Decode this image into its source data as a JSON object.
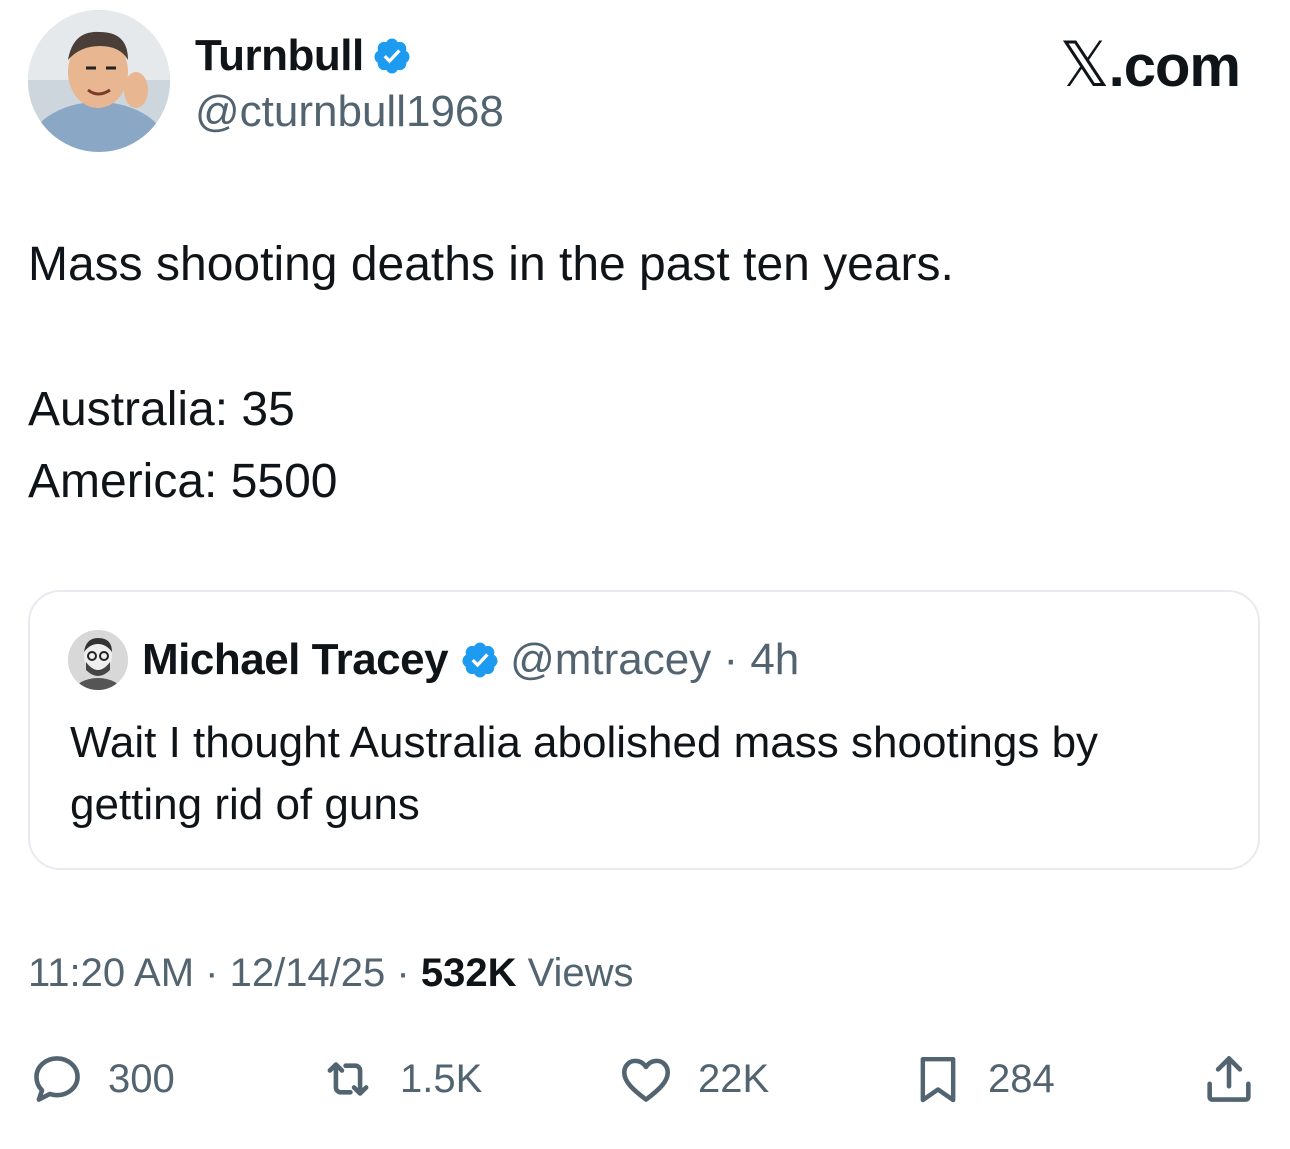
{
  "tweet": {
    "author": {
      "name": "Turnbull",
      "handle": "@cturnbull1968",
      "verified": true
    },
    "brand": {
      "label_x": "𝕏",
      "label_domain": ".com"
    },
    "lines": [
      "Mass shooting deaths in the past ten years.",
      "Australia: 35",
      "America: 5500"
    ],
    "quote": {
      "name": "Michael Tracey",
      "handle_time": "@mtracey · 4h",
      "text": "Wait I thought Australia abolished mass shootings by getting rid of guns"
    },
    "timestamp": {
      "time": "11:20 AM · 12/14/25 · ",
      "views_count": "532K",
      "views_label": " Views"
    },
    "actions": {
      "replies": "300",
      "reposts": "1.5K",
      "likes": "22K",
      "bookmarks": "284"
    }
  },
  "colors": {
    "text_primary": "#0f1419",
    "text_secondary": "#536471",
    "verified_blue": "#1d9bf0",
    "border": "#e7eaee"
  }
}
